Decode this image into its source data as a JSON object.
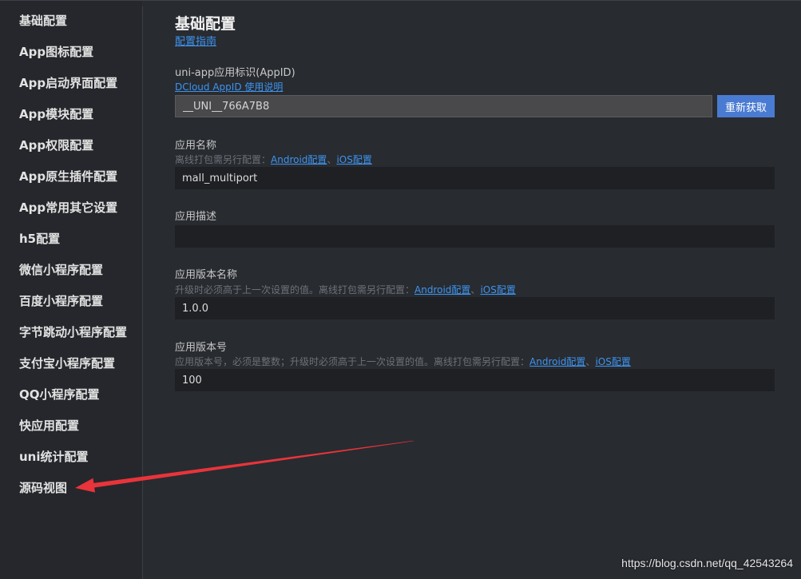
{
  "sidebar": {
    "items": [
      "基础配置",
      "App图标配置",
      "App启动界面配置",
      "App模块配置",
      "App权限配置",
      "App原生插件配置",
      "App常用其它设置",
      "h5配置",
      "微信小程序配置",
      "百度小程序配置",
      "字节跳动小程序配置",
      "支付宝小程序配置",
      "QQ小程序配置",
      "快应用配置",
      "uni统计配置",
      "源码视图"
    ]
  },
  "main": {
    "title": "基础配置",
    "guide_link": "配置指南",
    "appid": {
      "label": "uni-app应用标识(AppID)",
      "help_link": "DCloud AppID 使用说明",
      "value": "__UNI__766A7B8",
      "refresh_button": "重新获取"
    },
    "app_name": {
      "label": "应用名称",
      "desc_prefix": "离线打包需另行配置：",
      "android_link": "Android配置",
      "sep": "、",
      "ios_link": "iOS配置",
      "value": "mall_multiport"
    },
    "app_desc": {
      "label": "应用描述",
      "value": ""
    },
    "version_name": {
      "label": "应用版本名称",
      "desc_prefix": "升级时必须高于上一次设置的值。离线打包需另行配置：",
      "android_link": "Android配置",
      "sep": "、",
      "ios_link": "iOS配置",
      "value": "1.0.0"
    },
    "version_code": {
      "label": "应用版本号",
      "desc_prefix": "应用版本号，必须是整数；升级时必须高于上一次设置的值。离线打包需另行配置：",
      "android_link": "Android配置",
      "sep": "、",
      "ios_link": "iOS配置",
      "value": "100"
    }
  },
  "watermark": "https://blog.csdn.net/qq_42543264",
  "colors": {
    "background": "#282b30",
    "sidebar": "#25272c",
    "link": "#3d94f0",
    "button": "#4a7bd2",
    "annotation_arrow": "#e8343a"
  }
}
